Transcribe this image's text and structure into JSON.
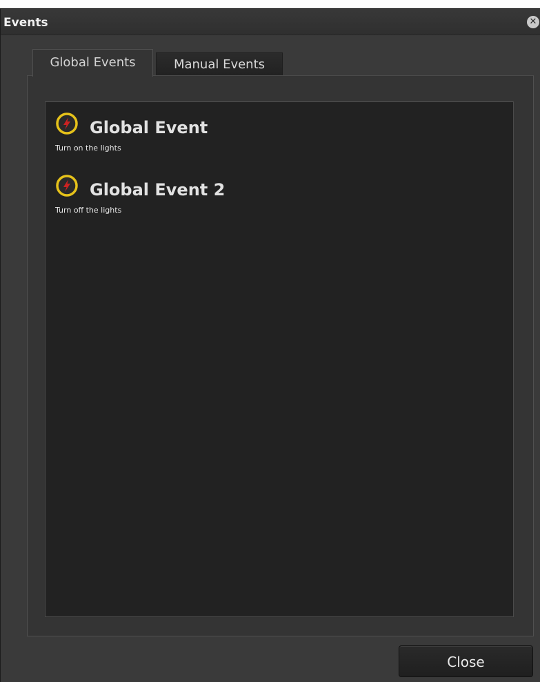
{
  "window": {
    "title": "Events",
    "close_icon": "close-circle-icon"
  },
  "tabs": [
    {
      "label": "Global Events",
      "selected": true
    },
    {
      "label": "Manual Events",
      "selected": false
    }
  ],
  "events": [
    {
      "icon": "lightning-bolt-icon",
      "title": "Global Event",
      "description": "Turn on the lights"
    },
    {
      "icon": "lightning-bolt-icon",
      "title": "Global Event 2",
      "description": "Turn off the lights"
    }
  ],
  "footer": {
    "close_label": "Close"
  },
  "colors": {
    "window_bg": "#3a3a3a",
    "panel_bg": "#222222",
    "icon_ring": "#e6c21a",
    "icon_bolt": "#cc2222"
  }
}
